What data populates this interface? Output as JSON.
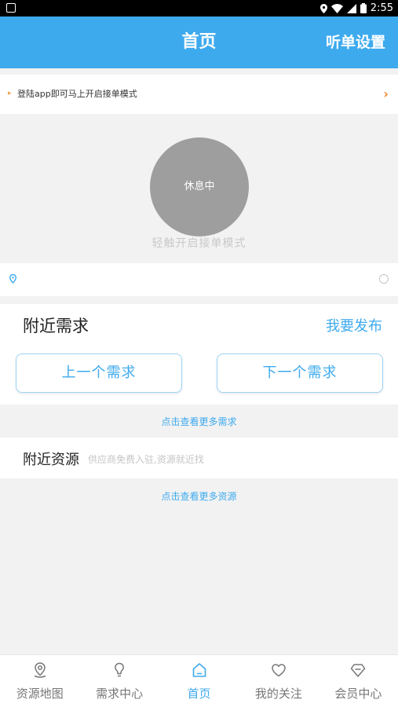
{
  "status_bar": {
    "time": "2:55"
  },
  "app_bar": {
    "title": "首页",
    "settings_label": "听单设置"
  },
  "notice": {
    "text": "登陆app即可马上开启接单模式"
  },
  "status_area": {
    "state_label": "休息中",
    "hint": "轻触开启接单模式"
  },
  "nearby_demand": {
    "title": "附近需求",
    "publish_label": "我要发布",
    "prev_label": "上一个需求",
    "next_label": "下一个需求",
    "more_label": "点击查看更多需求"
  },
  "nearby_resource": {
    "title": "附近资源",
    "subtitle": "供应商免费入驻,资源就近找",
    "more_label": "点击查看更多资源"
  },
  "tabs": [
    {
      "label": "资源地图",
      "icon": "map-pin-icon"
    },
    {
      "label": "需求中心",
      "icon": "lightbulb-icon"
    },
    {
      "label": "首页",
      "icon": "home-icon",
      "active": true
    },
    {
      "label": "我的关注",
      "icon": "heart-icon"
    },
    {
      "label": "会员中心",
      "icon": "diamond-icon"
    }
  ],
  "colors": {
    "accent": "#3eaaee",
    "rest_circle": "#9e9e9e"
  }
}
